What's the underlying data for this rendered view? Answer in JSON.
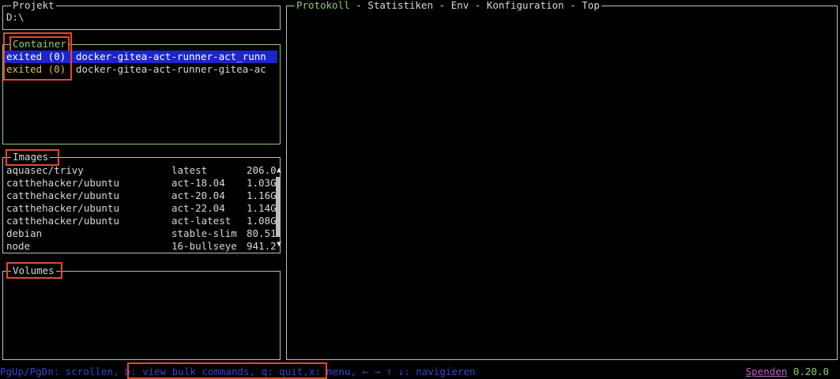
{
  "project": {
    "title": "Projekt",
    "path": "D:\\"
  },
  "containers": {
    "title": "Container",
    "items": [
      {
        "status": "exited (0)",
        "name": "docker-gitea-act-runner-act_runn",
        "selected": true
      },
      {
        "status": "exited (0)",
        "name": "docker-gitea-act-runner-gitea-ac",
        "selected": false
      }
    ]
  },
  "images": {
    "title": "Images",
    "scroll_up": "▲",
    "scroll_down": "▼",
    "items": [
      {
        "repo": "aquasec/trivy",
        "tag": "latest",
        "size": "206.0"
      },
      {
        "repo": "catthehacker/ubuntu",
        "tag": "act-18.04",
        "size": "1.03G"
      },
      {
        "repo": "catthehacker/ubuntu",
        "tag": "act-20.04",
        "size": "1.16G"
      },
      {
        "repo": "catthehacker/ubuntu",
        "tag": "act-22.04",
        "size": "1.14G"
      },
      {
        "repo": "catthehacker/ubuntu",
        "tag": "act-latest",
        "size": "1.08G"
      },
      {
        "repo": "debian",
        "tag": "stable-slim",
        "size": "80.51"
      },
      {
        "repo": "node",
        "tag": "16-bullseye",
        "size": "941.2"
      }
    ]
  },
  "volumes": {
    "title": "Volumes"
  },
  "main": {
    "tabs": [
      {
        "label": "Protokoll",
        "active": true
      },
      {
        "label": "Statistiken",
        "active": false
      },
      {
        "label": "Env",
        "active": false
      },
      {
        "label": "Konfiguration",
        "active": false
      },
      {
        "label": "Top",
        "active": false
      }
    ],
    "separator": " - "
  },
  "footer": {
    "scroll_hint": "PgUp/PgDn: scrollen, ",
    "bulk_hint": "b: view bulk commands, q: quit,",
    "nav_hint": " x: menu, ← → ↑ ↓: navigieren",
    "donate": "Spenden",
    "version": "0.20.0"
  },
  "colors": {
    "active_border": "#8fd06a",
    "selection": "#1c26c8",
    "exited": "#d8c14a",
    "footer_text": "#2e46d4",
    "highlight_box": "#e04a2f"
  }
}
